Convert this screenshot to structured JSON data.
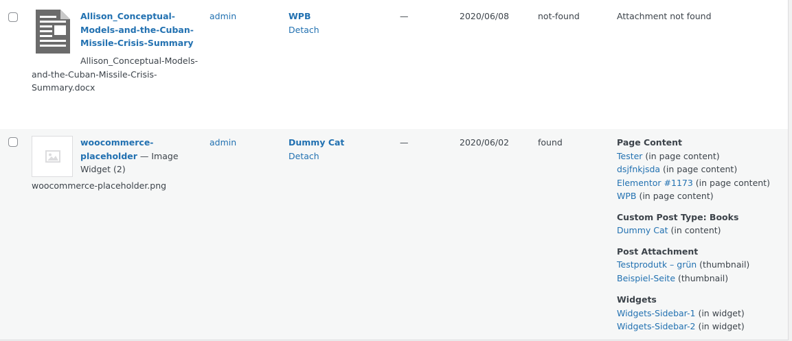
{
  "rows": [
    {
      "title_lines": [
        "Allison_Conceptual-",
        "Models-and-the-Cuban-",
        "Missile-Crisis-Summary"
      ],
      "filename_lines": [
        "Allison_Conceptual-Models-",
        "and-the-Cuban-Missile-Crisis-",
        "Summary.docx"
      ],
      "author": "admin",
      "uploaded_to": "WPB",
      "detach": "Detach",
      "comments": "—",
      "date": "2020/06/08",
      "status": "not-found",
      "usage_text": "Attachment not found",
      "thumbnail_icon": "document-icon"
    },
    {
      "title_lines": [
        "woocommerce-",
        "placeholder"
      ],
      "title_suffix_line2": " — Image",
      "title_suffix_line3": "Widget (2)",
      "filename_lines": [
        "woocommerce-placeholder.png"
      ],
      "author": "admin",
      "uploaded_to": "Dummy Cat",
      "detach": "Detach",
      "comments": "—",
      "date": "2020/06/02",
      "status": "found",
      "thumbnail_icon": "image-placeholder-icon",
      "usage_sections": [
        {
          "heading": "Page Content",
          "items": [
            {
              "link": "Tester",
              "note": " (in page content)"
            },
            {
              "link": "dsjfnkjsda",
              "note": " (in page content)"
            },
            {
              "link": "Elementor #1173",
              "note": " (in page content)"
            },
            {
              "link": "WPB",
              "note": " (in page content)"
            }
          ]
        },
        {
          "heading": "Custom Post Type: Books",
          "items": [
            {
              "link": "Dummy Cat",
              "note": " (in content)"
            }
          ]
        },
        {
          "heading": "Post Attachment",
          "items": [
            {
              "link": "Testprodutk – grün",
              "note": " (thumbnail)"
            },
            {
              "link": "Beispiel-Seite",
              "note": " (thumbnail)"
            }
          ]
        },
        {
          "heading": "Widgets",
          "items": [
            {
              "link": "Widgets-Sidebar-1",
              "note": " (in widget)"
            },
            {
              "link": "Widgets-Sidebar-2",
              "note": " (in widget)"
            }
          ]
        }
      ]
    }
  ],
  "colors": {
    "link": "#2271b1",
    "text": "#3c434a",
    "alt_row": "#f6f7f7"
  }
}
